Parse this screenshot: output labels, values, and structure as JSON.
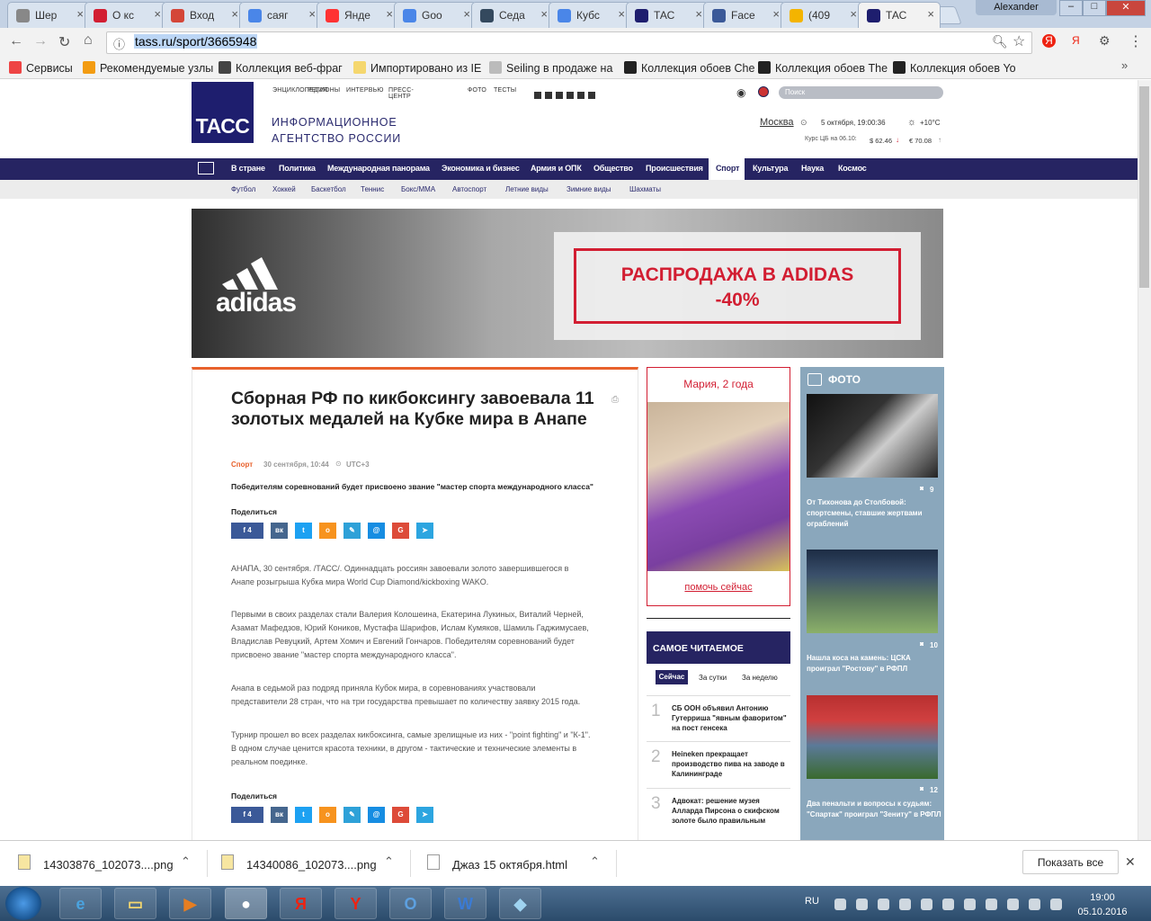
{
  "browser": {
    "tabs": [
      {
        "title": "Шер",
        "color": "#888"
      },
      {
        "title": "О кс",
        "color": "#d21e32"
      },
      {
        "title": "Вход",
        "color": "#d44638"
      },
      {
        "title": "саяг",
        "color": "#4a86e8"
      },
      {
        "title": "Янде",
        "color": "#f33"
      },
      {
        "title": "Goo",
        "color": "#4a86e8"
      },
      {
        "title": "Седа",
        "color": "#34495e"
      },
      {
        "title": "Кубс",
        "color": "#4a86e8"
      },
      {
        "title": "ТАС",
        "color": "#1e1e6e"
      },
      {
        "title": "Face",
        "color": "#3b5998"
      },
      {
        "title": "(409",
        "color": "#f4b400"
      },
      {
        "title": "ТАС",
        "color": "#1e1e6e"
      }
    ],
    "user_name": "Alexander",
    "url": "tass.ru/sport/3665948",
    "bookmarks": [
      {
        "label": "Сервисы",
        "color": "#e44"
      },
      {
        "label": "Рекомендуемые узлы",
        "color": "#f39c12"
      },
      {
        "label": "Коллекция веб-фраг",
        "color": "#444"
      },
      {
        "label": "Импортировано из IE",
        "color": "#f5d76e"
      },
      {
        "label": "Seiling в продаже на",
        "color": "#bbb"
      },
      {
        "label": "Коллекция обоев Che",
        "color": "#222"
      },
      {
        "label": "Коллекция обоев The",
        "color": "#222"
      },
      {
        "label": "Коллекция обоев Yo",
        "color": "#222"
      }
    ]
  },
  "site": {
    "top_links": [
      "ЭНЦИКЛОПЕДИЯ",
      "РЕГИОНЫ",
      "ИНТЕРВЬЮ",
      "ПРЕСС-ЦЕНТР",
      "ФОТО",
      "ТЕСТЫ"
    ],
    "search_placeholder": "Поиск",
    "logo": "ТАСС",
    "agency_line1": "ИНФОРМАЦИОННОЕ",
    "agency_line2": "АГЕНТСТВО РОССИИ",
    "city": "Москва",
    "date": "5 октября, 19:00:36",
    "weather": "+10°C",
    "rates_label": "Курс ЦБ на 06.10:",
    "usd": "$ 62.46",
    "eur": "€ 70.08",
    "nav": [
      "В стране",
      "Политика",
      "Международная панорама",
      "Экономика и бизнес",
      "Армия и ОПК",
      "Общество",
      "Происшествия",
      "Спорт",
      "Культура",
      "Наука",
      "Космос"
    ],
    "subnav": [
      "Футбол",
      "Хоккей",
      "Баскетбол",
      "Теннис",
      "Бокс/ММА",
      "Автоспорт",
      "Летние виды",
      "Зимние виды",
      "Шахматы"
    ]
  },
  "banner": {
    "brand": "adidas",
    "line1": "РАСПРОДАЖА В ADIDAS",
    "line2": "-40%"
  },
  "article": {
    "headline": "Сборная РФ по кикбоксингу завоевала 11 золотых медалей на Кубке мира в Анапе",
    "category": "Спорт",
    "date": "30 сентября, 10:44",
    "tz": "UTC+3",
    "lead": "Победителям соревнований будет присвоено звание \"мастер спорта международного класса\"",
    "share_label": "Поделиться",
    "fb_count": "4",
    "paragraphs": [
      "АНАПА, 30 сентября. /ТАСС/. Одиннадцать россиян завоевали золото завершившегося в Анапе розыгрыша Кубка мира World Cup Diamond/kickboxing WAKO.",
      "Первыми в своих разделах стали Валерия Колошеина, Екатерина Лукиных, Виталий Черней, Азамат Мафедзов, Юрий Коников, Мустафа Шарифов, Ислам Кумяков, Шамиль Гаджимусаев, Владислав Ревуцкий, Артем Хомич и Евгений Гончаров. Победителям соревнований будет присвоено звание \"мастер спорта международного класса\".",
      "Анапа в седьмой раз подряд приняла Кубок мира, в соревнованиях участвовали представители 28 стран, что на три государства превышает по количеству заявку 2015 года.",
      "Турнир прошел во всех разделах кикбоксинга, самые зрелищные из них - \"point fighting\" и \"К-1\". В одном случае ценится красота техники, в другом - тактические и технические элементы в реальном поединке."
    ]
  },
  "charity": {
    "name": "Мария, 2 года",
    "help": "помочь сейчас"
  },
  "popular": {
    "title": "САМОЕ ЧИТАЕМОЕ",
    "tabs": [
      "Сейчас",
      "За сутки",
      "За неделю"
    ],
    "items": [
      {
        "num": "1",
        "text": "СБ ООН объявил Антонию Гутерриша \"явным фаворитом\" на пост генсека"
      },
      {
        "num": "2",
        "text": "Heineken прекращает производство пива на заводе в Калининграде"
      },
      {
        "num": "3",
        "text": "Адвокат: решение музея Алларда Пирсона о скифском золоте было правильным"
      }
    ]
  },
  "photos": {
    "title": "ФОТО",
    "items": [
      {
        "count": "9",
        "caption": "От Тихонова до Столбовой: спортсмены, ставшие жертвами ограблений"
      },
      {
        "count": "10",
        "caption": "Нашла коса на камень: ЦСКА проиграл \"Ростову\" в РФПЛ"
      },
      {
        "count": "12",
        "caption": "Два пенальти и вопросы к судьям: \"Спартак\" проиграл \"Зениту\" в РФПЛ"
      }
    ]
  },
  "downloads": {
    "files": [
      "14303876_102073....png",
      "14340086_102073....png",
      "Джаз 15 октября.html"
    ],
    "show_all": "Показать все"
  },
  "taskbar": {
    "lang": "RU",
    "time": "19:00",
    "date": "05.10.2016"
  }
}
